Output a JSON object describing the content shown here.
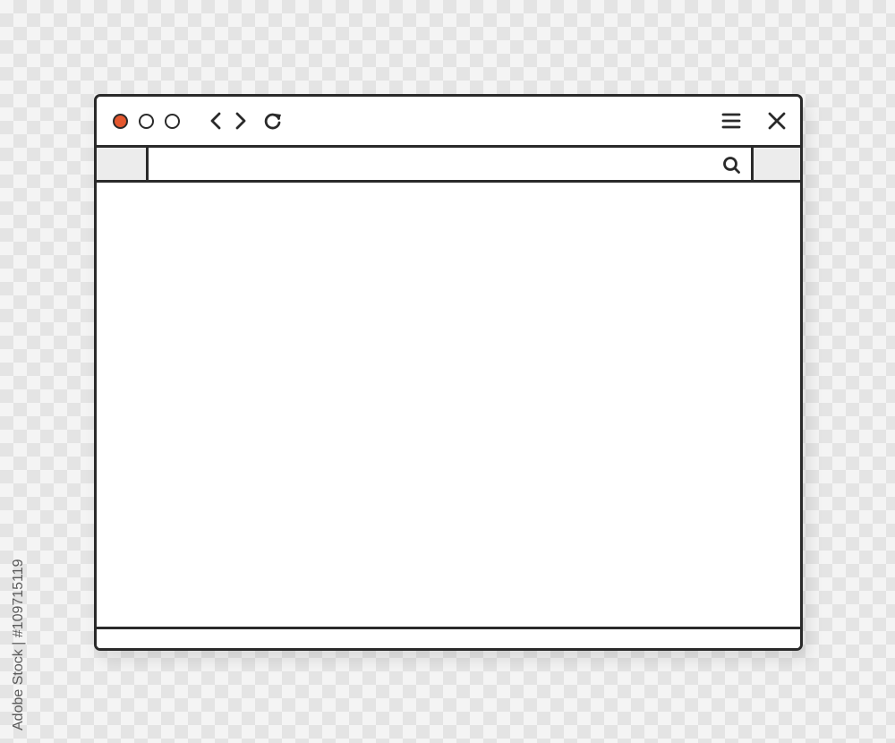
{
  "window": {
    "controls": [
      {
        "name": "close",
        "color": "#e4572e"
      },
      {
        "name": "minimize",
        "color": "#ffffff"
      },
      {
        "name": "maximize",
        "color": "#ffffff"
      }
    ],
    "nav_icons": [
      "chevron-left-icon",
      "chevron-right-icon",
      "reload-icon"
    ],
    "right_icons": [
      "hamburger-menu-icon",
      "close-icon"
    ]
  },
  "address_bar": {
    "url_value": "",
    "placeholder": "",
    "search_icon": "search-icon"
  },
  "content": {},
  "status_bar": {},
  "colors": {
    "outline": "#2a2a2a",
    "accent": "#e4572e",
    "tab_fill": "#ececec"
  },
  "watermark": {
    "stock_id_text": "Adobe Stock | #109715119"
  }
}
